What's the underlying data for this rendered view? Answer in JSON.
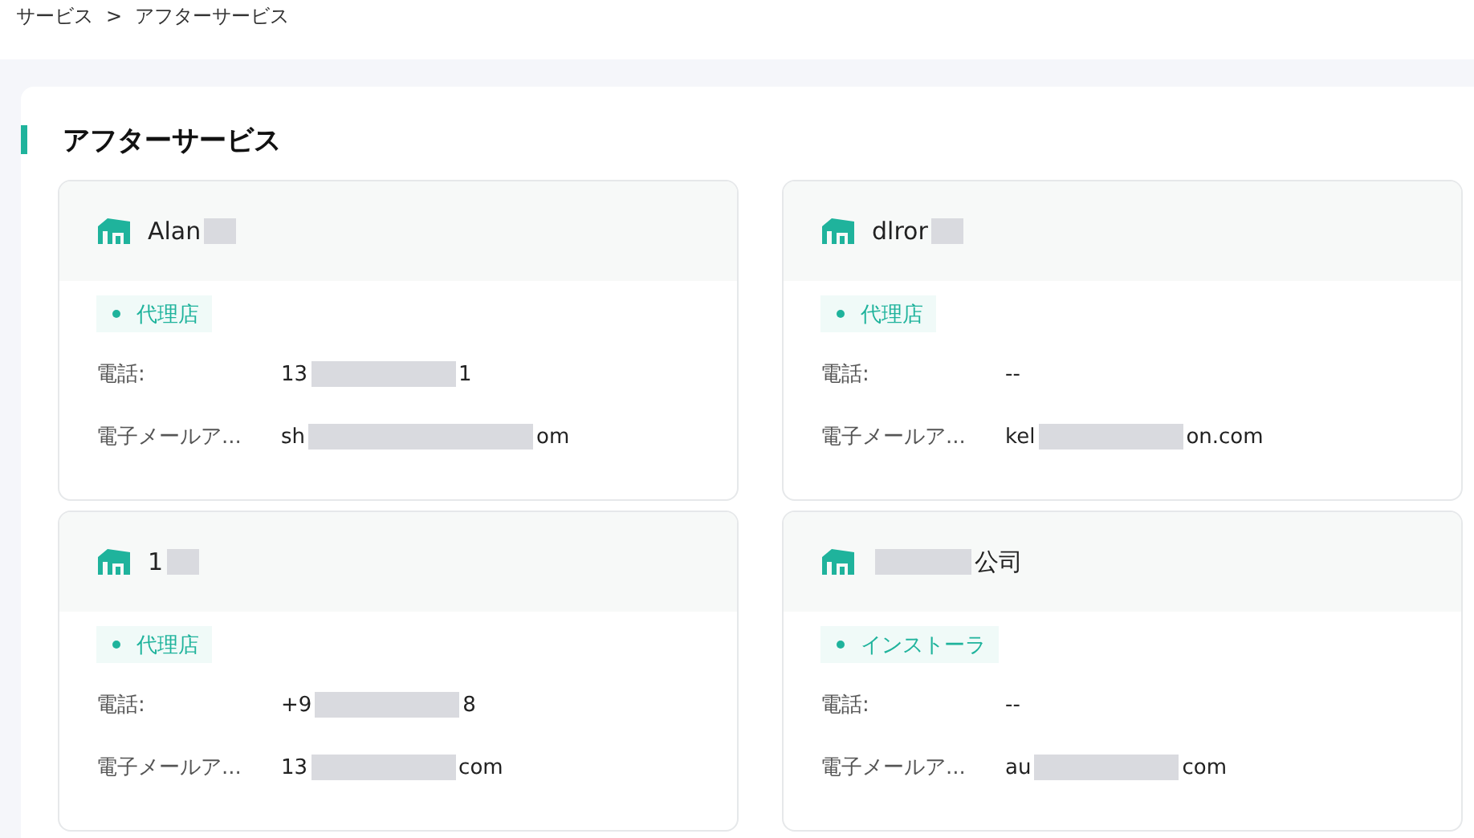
{
  "breadcrumb": {
    "items": [
      "サービス",
      "アフターサービス"
    ],
    "separator": ">"
  },
  "section": {
    "title": "アフターサービス"
  },
  "cards": [
    {
      "name": [
        {
          "kind": "text",
          "text": "Alan"
        },
        {
          "kind": "redacted"
        }
      ],
      "tag": "代理店",
      "fields": [
        {
          "label": "電話:",
          "value": [
            {
              "kind": "text",
              "text": "13"
            },
            {
              "kind": "redacted"
            },
            {
              "kind": "text",
              "text": "1"
            }
          ]
        },
        {
          "label": "電子メールア...",
          "value": [
            {
              "kind": "text",
              "text": "sh"
            },
            {
              "kind": "redacted"
            },
            {
              "kind": "text",
              "text": "om"
            }
          ]
        }
      ]
    },
    {
      "name": [
        {
          "kind": "text",
          "text": "dlror"
        },
        {
          "kind": "redacted"
        }
      ],
      "tag": "代理店",
      "fields": [
        {
          "label": "電話:",
          "value": [
            {
              "kind": "text",
              "text": "--"
            }
          ]
        },
        {
          "label": "電子メールア...",
          "value": [
            {
              "kind": "text",
              "text": "kel"
            },
            {
              "kind": "redacted"
            },
            {
              "kind": "text",
              "text": "on.com"
            }
          ]
        }
      ]
    },
    {
      "name": [
        {
          "kind": "text",
          "text": "1"
        },
        {
          "kind": "redacted"
        }
      ],
      "tag": "代理店",
      "fields": [
        {
          "label": "電話:",
          "value": [
            {
              "kind": "text",
              "text": "+9"
            },
            {
              "kind": "redacted"
            },
            {
              "kind": "text",
              "text": "8"
            }
          ]
        },
        {
          "label": "電子メールア...",
          "value": [
            {
              "kind": "text",
              "text": "13"
            },
            {
              "kind": "redacted"
            },
            {
              "kind": "text",
              "text": "com"
            }
          ]
        }
      ]
    },
    {
      "name": [
        {
          "kind": "redacted"
        },
        {
          "kind": "text",
          "text": "公司"
        }
      ],
      "tag": "インストーラ",
      "fields": [
        {
          "label": "電話:",
          "value": [
            {
              "kind": "text",
              "text": "--"
            }
          ]
        },
        {
          "label": "電子メールア...",
          "value": [
            {
              "kind": "text",
              "text": "au"
            },
            {
              "kind": "redacted"
            },
            {
              "kind": "text",
              "text": "com"
            }
          ]
        }
      ]
    }
  ]
}
